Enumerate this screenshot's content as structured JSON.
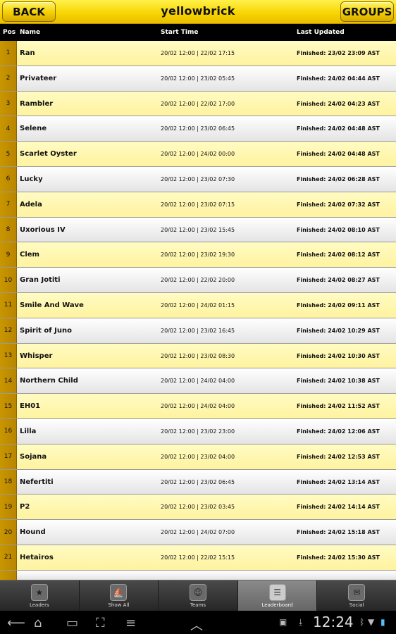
{
  "header": {
    "title": "yellowbrick",
    "back_label": "BACK",
    "groups_label": "GROUPS"
  },
  "columns": {
    "pos": "Pos",
    "name": "Name",
    "start": "Start Time",
    "updated": "Last Updated"
  },
  "rows": [
    {
      "pos": "1",
      "name": "Ran",
      "start": "20/02 12:00 | 22/02 17:15",
      "updated": "Finished: 23/02 23:09 AST"
    },
    {
      "pos": "2",
      "name": "Privateer",
      "start": "20/02 12:00 | 23/02 05:45",
      "updated": "Finished: 24/02 04:44 AST"
    },
    {
      "pos": "3",
      "name": "Rambler",
      "start": "20/02 12:00 | 22/02 17:00",
      "updated": "Finished: 24/02 04:23 AST"
    },
    {
      "pos": "4",
      "name": "Selene",
      "start": "20/02 12:00 | 23/02 06:45",
      "updated": "Finished: 24/02 04:48 AST"
    },
    {
      "pos": "5",
      "name": "Scarlet Oyster",
      "start": "20/02 12:00 | 24/02 00:00",
      "updated": "Finished: 24/02 04:48 AST"
    },
    {
      "pos": "6",
      "name": "Lucky",
      "start": "20/02 12:00 | 23/02 07:30",
      "updated": "Finished: 24/02 06:28 AST"
    },
    {
      "pos": "7",
      "name": "Adela",
      "start": "20/02 12:00 | 23/02 07:15",
      "updated": "Finished: 24/02 07:32 AST"
    },
    {
      "pos": "8",
      "name": "Uxorious IV",
      "start": "20/02 12:00 | 23/02 15:45",
      "updated": "Finished: 24/02 08:10 AST"
    },
    {
      "pos": "9",
      "name": "Clem",
      "start": "20/02 12:00 | 23/02 19:30",
      "updated": "Finished: 24/02 08:12 AST"
    },
    {
      "pos": "10",
      "name": "Gran Jotiti",
      "start": "20/02 12:00 | 22/02 20:00",
      "updated": "Finished: 24/02 08:27 AST"
    },
    {
      "pos": "11",
      "name": "Smile And Wave",
      "start": "20/02 12:00 | 24/02 01:15",
      "updated": "Finished: 24/02 09:11 AST"
    },
    {
      "pos": "12",
      "name": "Spirit of Juno",
      "start": "20/02 12:00 | 23/02 16:45",
      "updated": "Finished: 24/02 10:29 AST"
    },
    {
      "pos": "13",
      "name": "Whisper",
      "start": "20/02 12:00 | 23/02 08:30",
      "updated": "Finished: 24/02 10:30 AST"
    },
    {
      "pos": "14",
      "name": "Northern Child",
      "start": "20/02 12:00 | 24/02 04:00",
      "updated": "Finished: 24/02 10:38 AST"
    },
    {
      "pos": "15",
      "name": "EH01",
      "start": "20/02 12:00 | 24/02 04:00",
      "updated": "Finished: 24/02 11:52 AST"
    },
    {
      "pos": "16",
      "name": "Lilla",
      "start": "20/02 12:00 | 23/02 23:00",
      "updated": "Finished: 24/02 12:06 AST"
    },
    {
      "pos": "17",
      "name": "Sojana",
      "start": "20/02 12:00 | 23/02 04:00",
      "updated": "Finished: 24/02 12:53 AST"
    },
    {
      "pos": "18",
      "name": "Nefertiti",
      "start": "20/02 12:00 | 23/02 06:45",
      "updated": "Finished: 24/02 13:14 AST"
    },
    {
      "pos": "19",
      "name": "P2",
      "start": "20/02 12:00 | 23/02 03:45",
      "updated": "Finished: 24/02 14:14 AST"
    },
    {
      "pos": "20",
      "name": "Hound",
      "start": "20/02 12:00 | 24/02 07:00",
      "updated": "Finished: 24/02 15:18 AST"
    },
    {
      "pos": "21",
      "name": "Hetairos",
      "start": "20/02 12:00 | 22/02 15:15",
      "updated": "Finished: 24/02 15:30 AST"
    }
  ],
  "tabs": [
    {
      "label": "Leaders",
      "icon": "leaders-icon",
      "active": false
    },
    {
      "label": "Show All",
      "icon": "sailboat-icon",
      "active": false
    },
    {
      "label": "Teams",
      "icon": "teams-icon",
      "active": false
    },
    {
      "label": "Leaderboard",
      "icon": "leaderboard-icon",
      "active": true
    },
    {
      "label": "Social",
      "icon": "chat-bubble-icon",
      "active": false
    }
  ],
  "system": {
    "clock": "12:24"
  },
  "colors": {
    "accent_yellow": "#f7d300",
    "pos_column": "#c99600",
    "row_odd": "#fff6a8",
    "row_even": "#f0f0f0"
  }
}
